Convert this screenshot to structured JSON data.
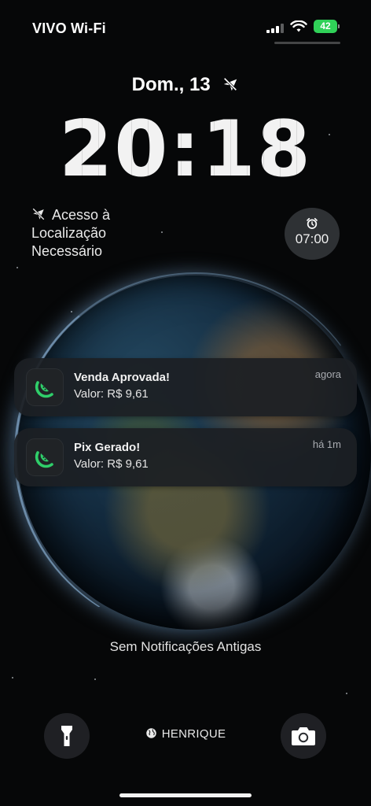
{
  "status_bar": {
    "carrier": "VIVO Wi-Fi",
    "battery_level": "42",
    "battery_color": "#30d158",
    "icons": [
      "signal-bars-icon",
      "wifi-icon",
      "battery-charging-icon"
    ]
  },
  "lock_screen": {
    "date": "Dom., 13",
    "date_icon": "airplane-off-icon",
    "time": "20:18",
    "location_widget": {
      "icon": "location-off-icon",
      "line1": "Acesso à",
      "line2": "Localização",
      "line3": "Necessário"
    },
    "alarm_widget": {
      "icon": "alarm-clock-icon",
      "time": "07:00"
    }
  },
  "notifications": [
    {
      "app_icon": "green-slice-logo-icon",
      "title": "Venda Aprovada!",
      "body": "Valor: R$ 9,61",
      "time": "agora"
    },
    {
      "app_icon": "green-slice-logo-icon",
      "title": "Pix Gerado!",
      "body": "Valor: R$ 9,61",
      "time": "há 1m"
    }
  ],
  "no_older_notifications": "Sem Notificações Antigas",
  "bottom_bar": {
    "flashlight_icon": "flashlight-icon",
    "owner_icon": "globe-icon",
    "owner_name": "HENRIQUE",
    "camera_icon": "camera-icon"
  },
  "colors": {
    "app_accent": "#2fcf6a",
    "notification_bg": "#1c1f23"
  }
}
